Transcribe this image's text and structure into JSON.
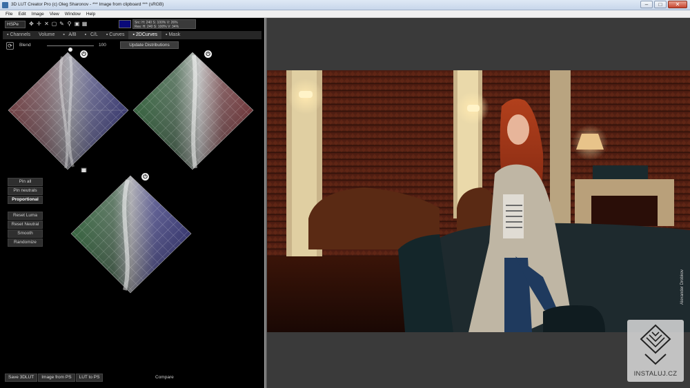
{
  "window": {
    "title": "3D LUT Creator Pro (c) Oleg Sharonov - *** Image from clipboard *** (sRGB)",
    "minimize": "–",
    "maximize": "□",
    "close": "✕"
  },
  "menu": [
    "File",
    "Edit",
    "Image",
    "View",
    "Window",
    "Help"
  ],
  "toolbar": {
    "mode": "HSPe",
    "icons": [
      "move-icon",
      "pan-icon",
      "crop-icon",
      "select-icon",
      "eyedropper-icon",
      "zoom-icon",
      "fit-icon",
      "grid-icon"
    ],
    "icon_glyphs": [
      "✥",
      "✛",
      "✕",
      "▢",
      "✎",
      "⚲",
      "▣",
      "▦"
    ],
    "swatch_color": "#0a0a7a",
    "readout_src": "Src: H: 240   S: 100% V: 26%",
    "readout_res": "Res: H: 240   S: 100% V: 34%"
  },
  "tabs": [
    {
      "label": "Channels",
      "active": false
    },
    {
      "label": "Volume",
      "active": false
    },
    {
      "label": "A/B",
      "active": false
    },
    {
      "label": "C/L",
      "active": false
    },
    {
      "label": "Curves",
      "active": false
    },
    {
      "label": "2DCurves",
      "active": true
    },
    {
      "label": "Mask",
      "active": false
    }
  ],
  "blend": {
    "label": "Blend",
    "value": "100",
    "level": 0.5,
    "reset_glyph": "⟳",
    "update_button": "Update Distributions"
  },
  "power_glyph": "⏻",
  "side_buttons": {
    "group1": [
      {
        "label": "Pin all",
        "active": false
      },
      {
        "label": "Pin neutrals",
        "active": false
      },
      {
        "label": "Proportional",
        "active": true
      }
    ],
    "group2": [
      {
        "label": "Reset Luma",
        "active": false
      },
      {
        "label": "Reset Neutral",
        "active": false
      },
      {
        "label": "Smooth",
        "active": false
      },
      {
        "label": "Randomize",
        "active": false
      }
    ]
  },
  "bottom": {
    "save_3dlut": "Save 3DLUT",
    "image_from_ps": "Image from PS",
    "lut_to_ps": "LUT to PS",
    "compare": "Compare"
  },
  "watermark": {
    "text": "INSTALUJ.CZ"
  }
}
